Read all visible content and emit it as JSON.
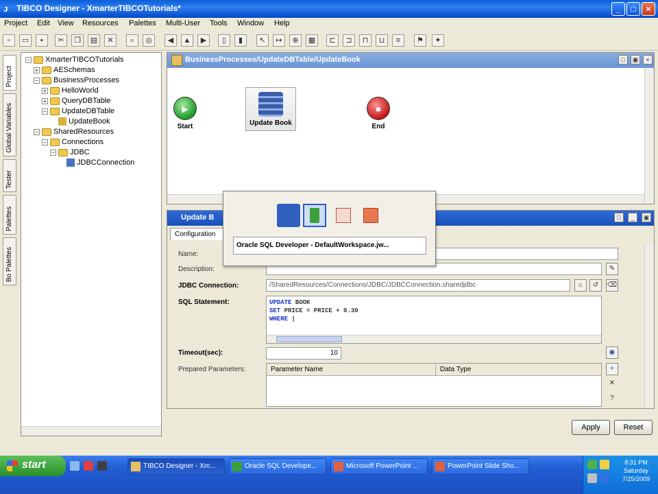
{
  "window": {
    "title": "TIBCO Designer - XmarterTIBCOTutorials*",
    "controls": {
      "minimize": "_",
      "maximize": "□",
      "close": "×"
    }
  },
  "menu": [
    "Project",
    "Edit",
    "View",
    "Resources",
    "Palettes",
    "Multi-User",
    "Tools",
    "Window",
    "Help"
  ],
  "side_tabs": [
    "Project",
    "Global Variables",
    "Tester",
    "Palettes",
    "Bo Palettes"
  ],
  "tree": [
    {
      "label": "XmarterTIBCOTutorials",
      "depth": 0,
      "expanded": true,
      "kind": "folder"
    },
    {
      "label": "AESchemas",
      "depth": 1,
      "expanded": false,
      "kind": "folder"
    },
    {
      "label": "BusinessProcesses",
      "depth": 1,
      "expanded": true,
      "kind": "folder"
    },
    {
      "label": "HelloWorld",
      "depth": 2,
      "expanded": false,
      "kind": "folder"
    },
    {
      "label": "QueryDBTable",
      "depth": 2,
      "expanded": false,
      "kind": "folder"
    },
    {
      "label": "UpdateDBTable",
      "depth": 2,
      "expanded": true,
      "kind": "folder"
    },
    {
      "label": "UpdateBook",
      "depth": 3,
      "expanded": null,
      "kind": "process"
    },
    {
      "label": "SharedResources",
      "depth": 1,
      "expanded": true,
      "kind": "folder"
    },
    {
      "label": "Connections",
      "depth": 2,
      "expanded": true,
      "kind": "folder"
    },
    {
      "label": "JDBC",
      "depth": 3,
      "expanded": true,
      "kind": "folder"
    },
    {
      "label": "JDBCConnection",
      "depth": 4,
      "expanded": null,
      "kind": "jdbc"
    }
  ],
  "process": {
    "title": "BusinessProcesses/UpdateDBTable/UpdateBook",
    "nodes": {
      "start": "Start",
      "activity": "Update Book",
      "end": "End"
    }
  },
  "properties": {
    "title": "Update B",
    "tab": "Configuration",
    "labels": {
      "name": "Name:",
      "description": "Description:",
      "jdbc_connection": "JDBC Connection:",
      "sql_statement": "SQL Statement:",
      "timeout": "Timeout(sec):",
      "prepared_parameters": "Prepared Parameters:"
    },
    "jdbc_connection_value": "/SharedResources/Connections/JDBC/JDBCConnection.sharedjdbc",
    "sql": [
      {
        "kw": "UPDATE",
        "rest": " BOOK"
      },
      {
        "kw": "SET",
        "rest": " PRICE = PRICE + 0.30"
      },
      {
        "kw": "WHERE",
        "rest": " |"
      }
    ],
    "timeout_value": "10",
    "grid_columns": [
      "Parameter Name",
      "Data Type"
    ],
    "buttons": {
      "apply": "Apply",
      "reset": "Reset"
    }
  },
  "switcher": {
    "label": "Oracle SQL Developer - DefaultWorkspace.jw..."
  },
  "taskbar": {
    "start": "start",
    "tasks": [
      "TIBCO Designer - Xm...",
      "Oracle SQL Develope...",
      "Microsoft PowerPoint ...",
      "PowerPoint Slide Sho..."
    ],
    "tray_time": "8:31 PM",
    "tray_day": "Saturday",
    "tray_date": "7/25/2009"
  },
  "colors": {
    "title_bar": "#0a5fd8",
    "process_header": "#6a94d6",
    "props_header": "#1a4fb8",
    "start_node": "#1f9a2b",
    "end_node": "#c01818",
    "sql_keyword": "#1030c0"
  }
}
